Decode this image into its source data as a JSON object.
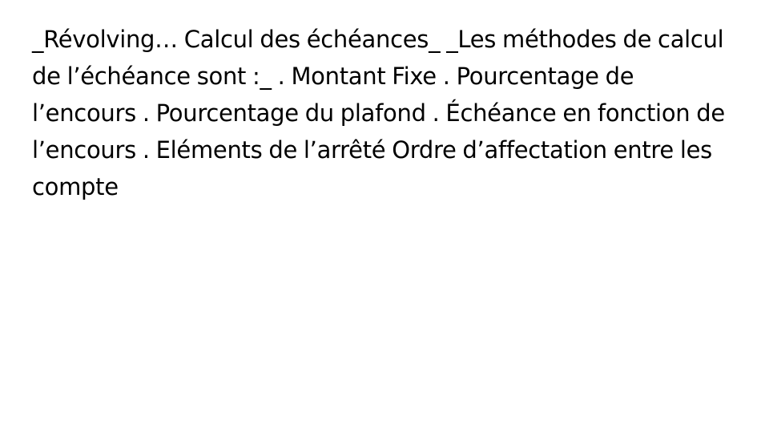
{
  "slide": {
    "body_text": "_Révolving… Calcul des échéances_ _Les méthodes de calcul de l’échéance sont :_ . Montant Fixe . Pourcentage de l’encours . Pourcentage du plafond . Échéance en fonction de l’encours . Eléments de l’arrêté Ordre d’affectation entre les compte"
  },
  "colors": {
    "background": "#ffffff",
    "text": "#000000"
  }
}
